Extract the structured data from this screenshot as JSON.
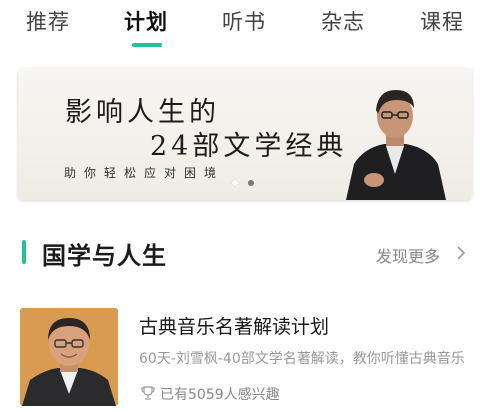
{
  "tabs": [
    {
      "label": "推荐",
      "active": false
    },
    {
      "label": "计划",
      "active": true
    },
    {
      "label": "听书",
      "active": false
    },
    {
      "label": "杂志",
      "active": false
    },
    {
      "label": "课程",
      "active": false
    }
  ],
  "accent_color": "#25c196",
  "banner": {
    "line1": "影响人生的",
    "line2": "24部文学经典",
    "subtitle": "助你轻松应对困境",
    "carousel_pages": 2,
    "carousel_active_index": 0
  },
  "section": {
    "title": "国学与人生",
    "more_label": "发现更多",
    "more_icon": "chevron-right-icon"
  },
  "list": [
    {
      "title": "古典音乐名著解读计划",
      "description": "60天-刘雪枫-40部文学名著解读，教你听懂古典音乐",
      "meta_icon": "trophy-icon",
      "meta": "已有5059人感兴趣"
    }
  ]
}
